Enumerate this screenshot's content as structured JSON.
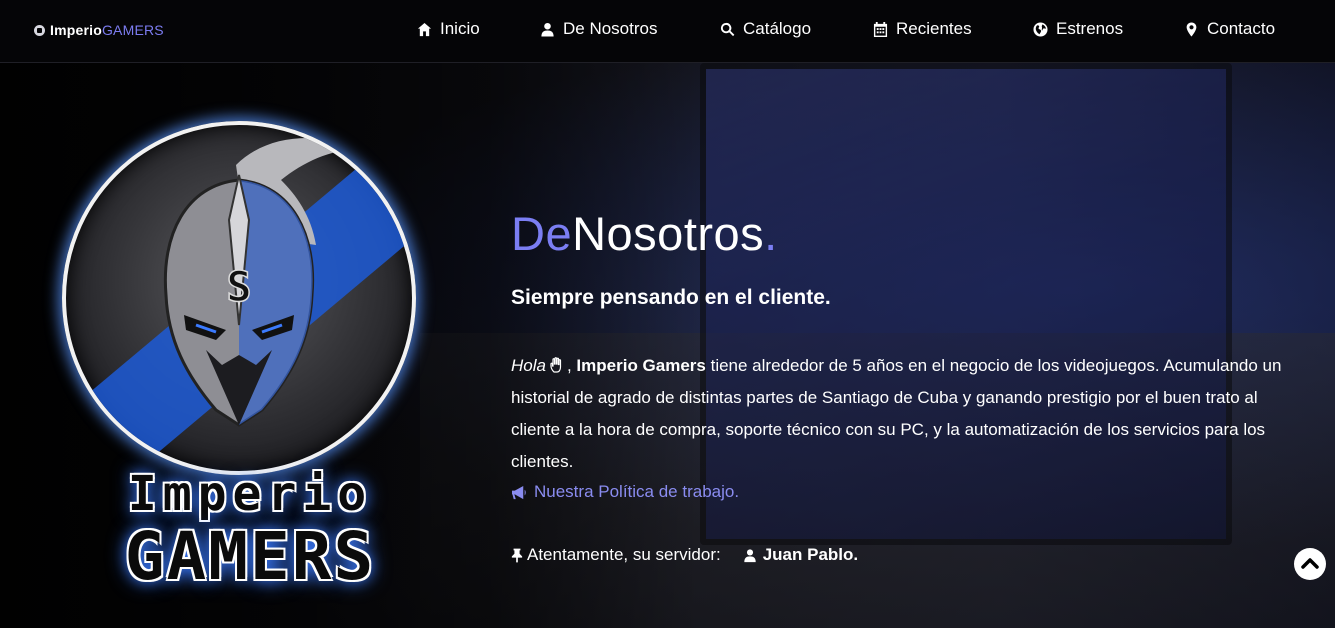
{
  "brand": {
    "part1": "Imperio",
    "part2": "GAMERS"
  },
  "nav": [
    {
      "label": "Inicio",
      "icon": "home-icon"
    },
    {
      "label": "De Nosotros",
      "icon": "user-icon"
    },
    {
      "label": "Catálogo",
      "icon": "search-icon"
    },
    {
      "label": "Recientes",
      "icon": "calendar-icon"
    },
    {
      "label": "Estrenos",
      "icon": "globe-icon"
    },
    {
      "label": "Contacto",
      "icon": "map-pin-icon"
    }
  ],
  "logo": {
    "line1": "Imperio",
    "line2": "GAMERS",
    "emblem_letter": "S"
  },
  "hero": {
    "title_part1": "De",
    "title_part2": "Nosotros",
    "title_dot": ".",
    "subtitle": "Siempre pensando en el cliente.",
    "greeting": "Hola",
    "company": "Imperio Gamers",
    "text1": " tiene alrededor de 5 años en el negocio de los videojuegos. Acumulando un historial de agrado de distintas partes de Santiago de Cuba y ganando prestigio por el buen trato al cliente a la hora de compra, soporte técnico con su PC, y la automatización de los servicios para los clientes.",
    "policy_link": "Nuestra Política de trabajo.",
    "signoff": "Atentamente, su servidor:",
    "author": "Juan Pablo."
  },
  "colors": {
    "accent": "#7b7ef3",
    "glow": "#3b7bff",
    "navbar_bg": "#050507"
  }
}
